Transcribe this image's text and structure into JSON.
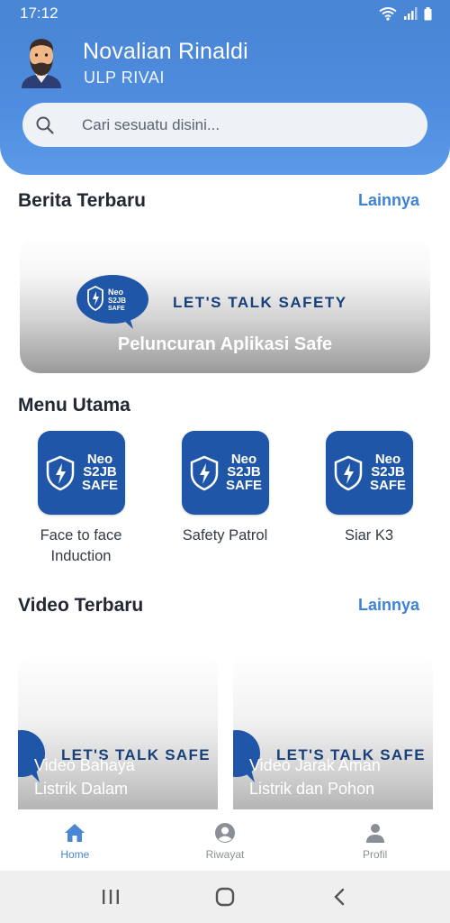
{
  "status_bar": {
    "time": "17:12"
  },
  "user": {
    "name": "Novalian Rinaldi",
    "unit": "ULP RIVAI"
  },
  "search": {
    "placeholder": "Cari sesuatu disini..."
  },
  "news": {
    "section_title": "Berita Terbaru",
    "more_label": "Lainnya",
    "banner": {
      "logo_text": [
        "Neo",
        "S2JB",
        "SAFE"
      ],
      "slogan": "LET'S TALK SAFETY",
      "title": "Peluncuran Aplikasi Safe"
    }
  },
  "menu": {
    "section_title": "Menu Utama",
    "brand_lines": [
      "Neo",
      "S2JB",
      "SAFE"
    ],
    "items": [
      {
        "label_line1": "Face to face",
        "label_line2": "Induction"
      },
      {
        "label_line1": "Safety Patrol",
        "label_line2": ""
      },
      {
        "label_line1": "Siar K3",
        "label_line2": ""
      }
    ]
  },
  "videos": {
    "section_title": "Video Terbaru",
    "more_label": "Lainnya",
    "items": [
      {
        "slogan": "LET'S TALK SAFE",
        "title_line1": "Video Bahaya",
        "title_line2": "Listrik Dalam"
      },
      {
        "slogan": "LET'S TALK SAFE",
        "title_line1": "Video Jarak Aman",
        "title_line2": "Listrik dan Pohon"
      }
    ]
  },
  "bottom_nav": [
    {
      "label": "Home",
      "icon": "home-icon",
      "active": true
    },
    {
      "label": "Riwayat",
      "icon": "user-circle-icon",
      "active": false
    },
    {
      "label": "Profil",
      "icon": "person-icon",
      "active": false
    }
  ],
  "colors": {
    "primary": "#4a86d6",
    "brand_blue": "#1f56a8",
    "link": "#3d82d6",
    "nav_inactive": "#8a8f97"
  }
}
